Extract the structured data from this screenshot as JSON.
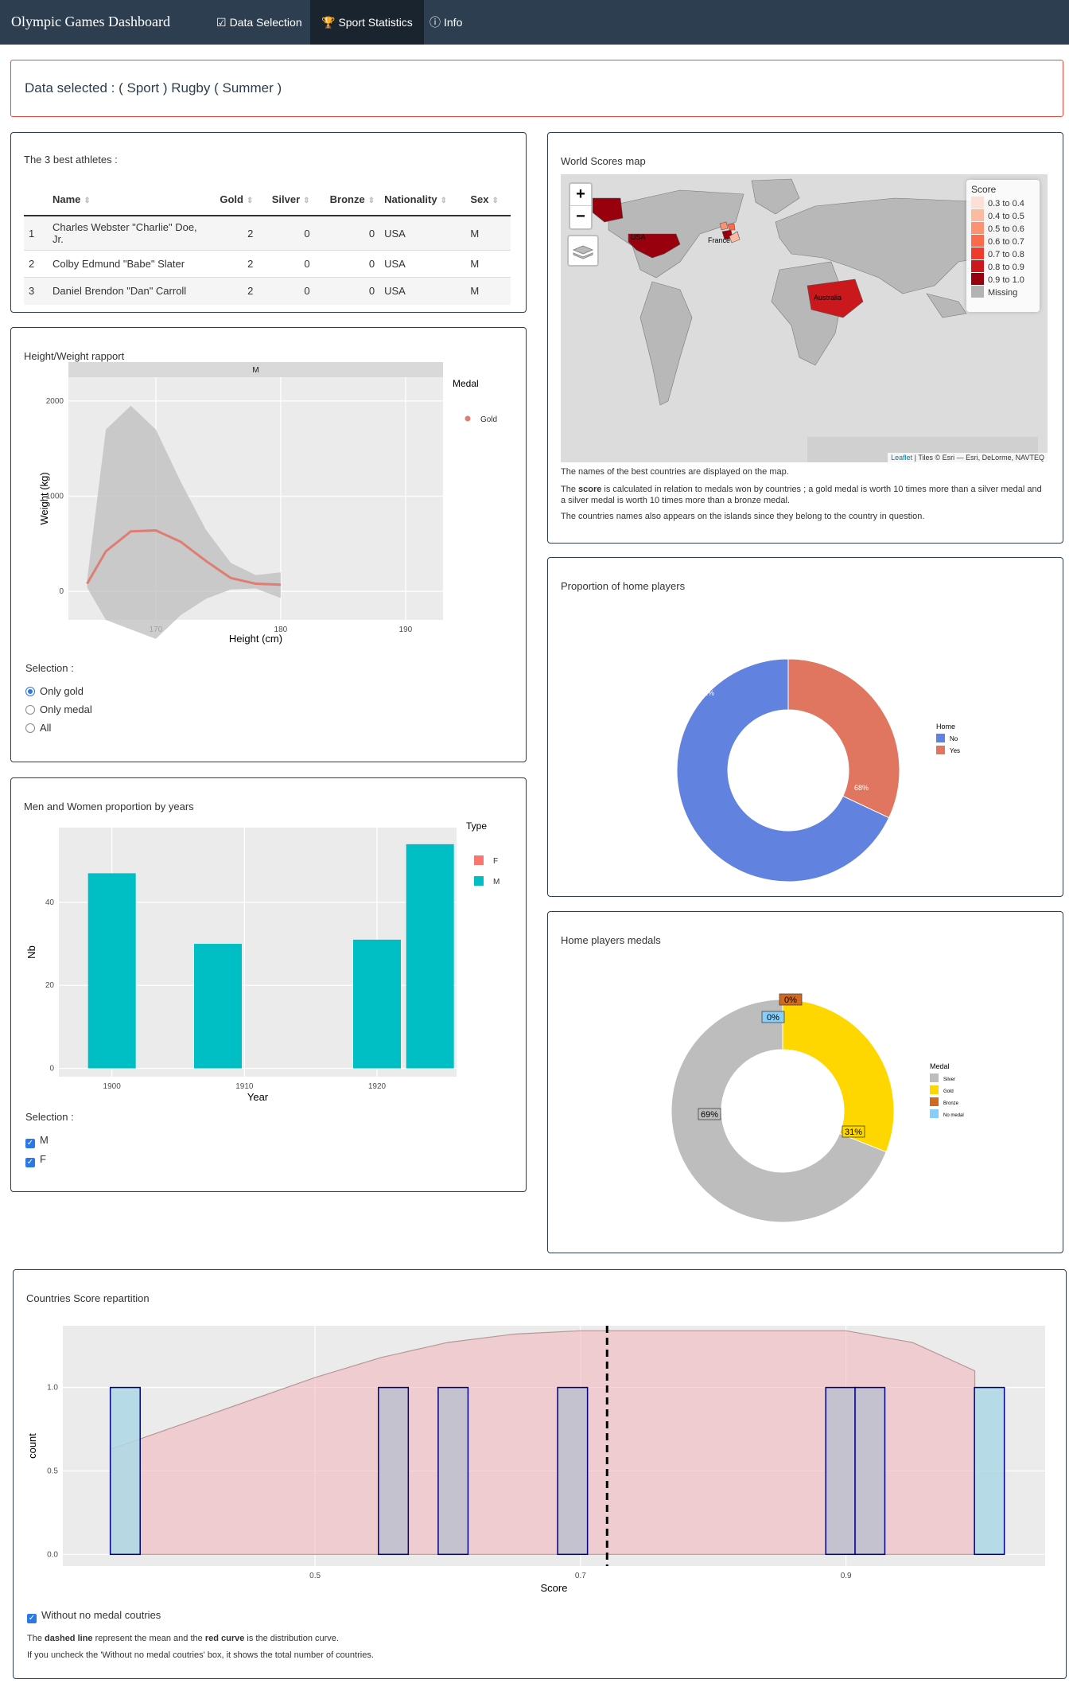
{
  "navbar": {
    "brand": "Olympic Games Dashboard",
    "tabs": [
      {
        "label": "Data Selection",
        "icon": "check-square-icon",
        "active": false
      },
      {
        "label": "Sport Statistics",
        "icon": "trophy-icon",
        "active": true
      },
      {
        "label": "Info",
        "icon": "info-circle-icon",
        "active": false
      }
    ],
    "colors": {
      "bg": "#2c3e50",
      "active": "#1a242f"
    }
  },
  "selection_banner": "Data selected : ( Sport ) Rugby ( Summer )",
  "athletes": {
    "title": "The 3 best athletes :",
    "columns": [
      "",
      "Name",
      "Gold",
      "Silver",
      "Bronze",
      "Nationality",
      "Sex"
    ],
    "rows": [
      {
        "rank": "1",
        "name": "Charles Webster \"Charlie\" Doe, Jr.",
        "gold": "2",
        "silver": "0",
        "bronze": "0",
        "nat": "USA",
        "sex": "M"
      },
      {
        "rank": "2",
        "name": "Colby Edmund \"Babe\" Slater",
        "gold": "2",
        "silver": "0",
        "bronze": "0",
        "nat": "USA",
        "sex": "M"
      },
      {
        "rank": "3",
        "name": "Daniel Brendon \"Dan\" Carroll",
        "gold": "2",
        "silver": "0",
        "bronze": "0",
        "nat": "USA",
        "sex": "M"
      }
    ]
  },
  "height_weight": {
    "title": "Height/Weight rapport",
    "facet": "M",
    "legend_title": "Medal",
    "legend_item": "Gold",
    "selection_label": "Selection :",
    "options": [
      {
        "label": "Only gold",
        "checked": true
      },
      {
        "label": "Only medal",
        "checked": false
      },
      {
        "label": "All",
        "checked": false
      }
    ]
  },
  "men_women": {
    "title": "Men and Women proportion by years",
    "legend_title": "Type",
    "selection_label": "Selection :",
    "checks": [
      {
        "label": "M",
        "checked": true
      },
      {
        "label": "F",
        "checked": true
      }
    ]
  },
  "world_map": {
    "title": "World Scores map",
    "zoom_in": "+",
    "zoom_out": "−",
    "legend_title": "Score",
    "legend": [
      {
        "label": "0.3 to 0.4",
        "color": "#fde0d5"
      },
      {
        "label": "0.4 to 0.5",
        "color": "#fcbba1"
      },
      {
        "label": "0.5 to 0.6",
        "color": "#fc9272"
      },
      {
        "label": "0.6 to 0.7",
        "color": "#fb6a4a"
      },
      {
        "label": "0.7 to 0.8",
        "color": "#ef3b2c"
      },
      {
        "label": "0.8 to 0.9",
        "color": "#cb181d"
      },
      {
        "label": "0.9 to 1.0",
        "color": "#99000d"
      },
      {
        "label": "Missing",
        "color": "#b3b3b3"
      }
    ],
    "country_labels": [
      "USA",
      "France",
      "Australia"
    ],
    "attribution_link": "Leaflet",
    "attribution_rest": " | Tiles © Esri — Esri, DeLorme, NAVTEQ",
    "note1": "The names of the best countries are displayed on the map.",
    "note2_pre": "The ",
    "note2_bold": "score",
    "note2_post": " is calculated in relation to medals won by countries ; a gold medal is worth 10 times more than a silver medal and a silver medal is worth 10 times more than a bronze medal.",
    "note3": "The countries names also appears on the islands since they belong to the country in question."
  },
  "home_players": {
    "title": "Proportion of home players",
    "legend_title": "Home"
  },
  "home_medals": {
    "title": "Home players medals",
    "legend_title": "Medal"
  },
  "score_rep": {
    "title": "Countries Score repartition",
    "checkbox_label": "Without no medal coutries",
    "note1_pre": "The ",
    "note1_b1": "dashed line",
    "note1_mid": " represent the mean and the ",
    "note1_b2": "red curve",
    "note1_post": " is the distribution curve.",
    "note2": "If you uncheck the 'Without no medal coutries' box, it shows the total number of countries."
  },
  "chart_data": [
    {
      "type": "line",
      "facet": "M",
      "xlabel": "Height (cm)",
      "ylabel": "Weight (kg)",
      "xlim": [
        163,
        193
      ],
      "ylim": [
        -300,
        2250
      ],
      "xticks": [
        170,
        180,
        190
      ],
      "yticks": [
        0,
        1000,
        2000
      ],
      "legend": "Gold",
      "series": [
        {
          "name": "Gold",
          "color": "#e07d72",
          "x": [
            164.5,
            166,
            168,
            170,
            172,
            174,
            176,
            178,
            180
          ],
          "y": [
            80,
            420,
            630,
            640,
            520,
            320,
            140,
            80,
            70
          ],
          "upper": [
            120,
            1700,
            1950,
            1700,
            1150,
            650,
            300,
            170,
            200
          ],
          "lower": [
            40,
            -300,
            -400,
            -500,
            -250,
            -80,
            20,
            30,
            -70
          ]
        }
      ]
    },
    {
      "type": "bar",
      "xlabel": "Year",
      "ylabel": "Nb",
      "xlim": [
        1896,
        1926
      ],
      "ylim": [
        -2,
        58
      ],
      "xticks": [
        1900,
        1910,
        1920
      ],
      "yticks": [
        0,
        20,
        40
      ],
      "categories": [
        "1900",
        "1908",
        "1920",
        "1924"
      ],
      "x": [
        1900,
        1908,
        1920,
        1924
      ],
      "series": [
        {
          "name": "F",
          "color": "#f8766d",
          "values": [
            0,
            0,
            0,
            0
          ]
        },
        {
          "name": "M",
          "color": "#00bfc4",
          "values": [
            47,
            30,
            31,
            54
          ]
        }
      ]
    },
    {
      "type": "pie",
      "legend_title": "Home",
      "slices": [
        {
          "label": "No",
          "value": 68,
          "color": "#6282e0",
          "text": "68%"
        },
        {
          "label": "Yes",
          "value": 32,
          "color": "#e07560",
          "text": "32%"
        }
      ]
    },
    {
      "type": "pie",
      "legend_title": "Medal",
      "slices": [
        {
          "label": "Silver",
          "value": 69,
          "color": "#bdbdbd",
          "text": "69%"
        },
        {
          "label": "Gold",
          "value": 31,
          "color": "#ffd700",
          "text": "31%"
        },
        {
          "label": "Bronze",
          "value": 0,
          "color": "#d2691e",
          "text": "0%"
        },
        {
          "label": "No medal",
          "value": 0,
          "color": "#87cefa",
          "text": "0%"
        }
      ]
    },
    {
      "type": "bar",
      "xlabel": "Score",
      "ylabel": "count",
      "xlim": [
        0.31,
        1.05
      ],
      "ylim": [
        -0.07,
        1.37
      ],
      "xticks": [
        0.5,
        0.7,
        0.9
      ],
      "yticks": [
        0.0,
        0.5,
        1.0
      ],
      "mean": 0.72,
      "bin_width": 0.0225,
      "bins": [
        {
          "x": 0.357,
          "count": 1,
          "color": "#add8e6"
        },
        {
          "x": 0.559,
          "count": 1,
          "color": "#bcbfcf"
        },
        {
          "x": 0.604,
          "count": 1,
          "color": "#bcbfcf"
        },
        {
          "x": 0.694,
          "count": 1,
          "color": "#bcbfcf"
        },
        {
          "x": 0.896,
          "count": 1,
          "color": "#bcbfcf"
        },
        {
          "x": 0.918,
          "count": 1,
          "color": "#bcbfcf"
        },
        {
          "x": 1.008,
          "count": 1,
          "color": "#add8e6"
        }
      ],
      "density": {
        "x": [
          0.346,
          0.4,
          0.45,
          0.5,
          0.55,
          0.6,
          0.65,
          0.7,
          0.75,
          0.8,
          0.85,
          0.9,
          0.95,
          0.997
        ],
        "y": [
          0.63,
          0.78,
          0.92,
          1.06,
          1.18,
          1.27,
          1.32,
          1.34,
          1.34,
          1.34,
          1.34,
          1.34,
          1.27,
          1.1
        ]
      }
    }
  ]
}
